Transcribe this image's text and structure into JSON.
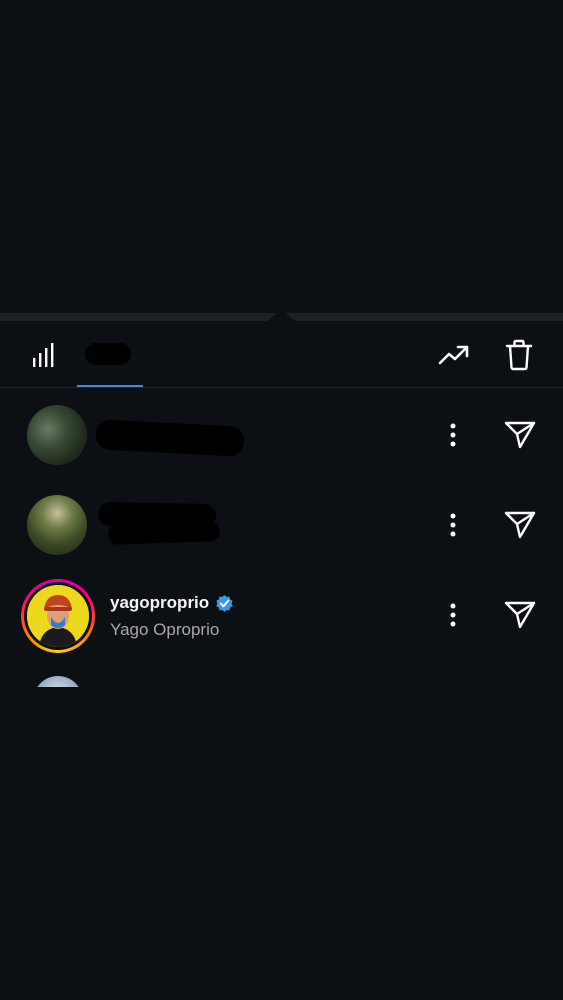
{
  "tabs": {
    "stats_icon": "bar-chart-icon",
    "viewers_icon": "eye-icon",
    "active": "viewers"
  },
  "toolbar": {
    "trend_icon": "trending-up-icon",
    "delete_icon": "trash-icon"
  },
  "viewers": [
    {
      "username": "",
      "full_name": "",
      "redacted": true,
      "verified": false,
      "has_story_ring": false
    },
    {
      "username": "",
      "full_name": "",
      "redacted": true,
      "verified": false,
      "has_story_ring": false
    },
    {
      "username": "yagoproprio",
      "full_name": "Yago Oproprio",
      "redacted": false,
      "verified": true,
      "has_story_ring": true
    }
  ],
  "colors": {
    "background": "#0c1014",
    "accent_underline": "#3d8fd6",
    "verified_badge": "#3897f0",
    "secondary_text": "#a8a8a8"
  }
}
